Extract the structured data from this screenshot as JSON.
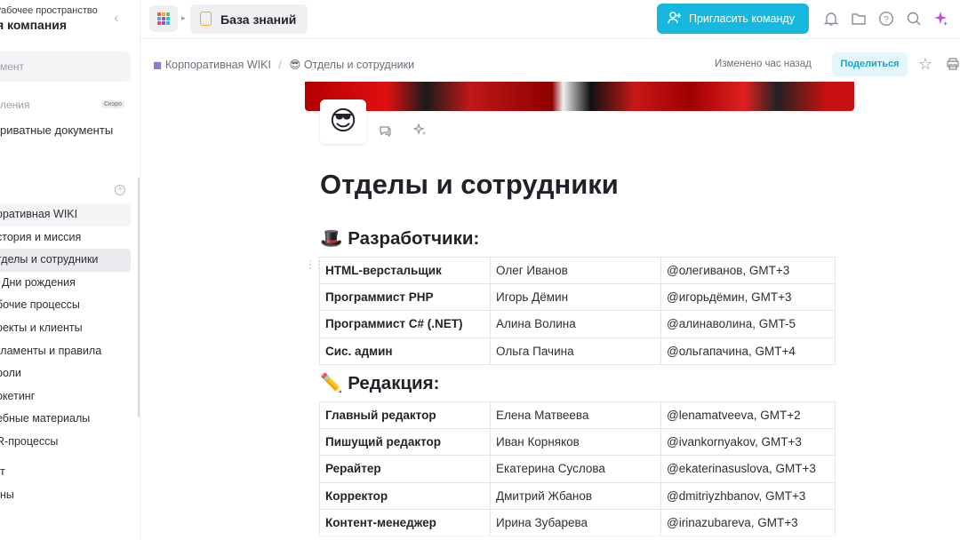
{
  "sidebar": {
    "workspace_sub": "Рабочее пространство",
    "workspace_name": "я компания",
    "search_text": "мент",
    "soon_label": "ления",
    "soon_badge": "Скоро",
    "private_docs": "риватные документы",
    "tree": [
      "оративная WIKI",
      "стория и миссия",
      "тделы и сотрудники",
      "Дни рождения",
      "бочие процессы",
      "оекты и клиенты",
      "гламенты и правила",
      "роли",
      "ркетинг",
      "ебные материалы",
      "R-процессы"
    ],
    "bottom": [
      "т",
      "ны"
    ]
  },
  "topbar": {
    "kb_label": "База знаний",
    "invite_label": "Пригласить команду"
  },
  "breadcrumbs": {
    "root": "Корпоративная WIKI",
    "current": "Отделы и сотрудники",
    "changed": "Изменено час назад",
    "share": "Поделиться"
  },
  "doc": {
    "emoji": "😎",
    "title": "Отделы и сотрудники",
    "sections": [
      {
        "heading": "🎩 Разработчики:",
        "rows": [
          [
            "HTML-верстальщик",
            "Олег Иванов",
            "@олегиванов, GMT+3"
          ],
          [
            "Программист PHP",
            "Игорь Дёмин",
            "@игорьдёмин, GMT+3"
          ],
          [
            "Программист C# (.NET)",
            "Алина Волина",
            "@алинаволина, GMT-5"
          ],
          [
            "Сис. админ",
            "Ольга Пачина",
            "@ольгапачина, GMT+4"
          ]
        ]
      },
      {
        "heading": "✏️ Редакция:",
        "rows": [
          [
            "Главный редактор",
            "Елена Матвеева",
            "@lenamatveeva, GMT+2"
          ],
          [
            "Пишущий редактор",
            "Иван Корняков",
            "@ivankornyakov, GMT+3"
          ],
          [
            "Рерайтер",
            "Екатерина Суслова",
            "@ekaterinasuslova, GMT+3"
          ],
          [
            "Корректор",
            "Дмитрий Жбанов",
            "@dmitriyzhbanov, GMT+3"
          ],
          [
            "Контент-менеджер",
            "Ирина Зубарева",
            "@irinazubareva, GMT+3"
          ]
        ]
      }
    ]
  },
  "colors": {
    "accent": "#16b8de",
    "share_bg": "#e3f6fb",
    "doc_icon": "#f5a623"
  }
}
